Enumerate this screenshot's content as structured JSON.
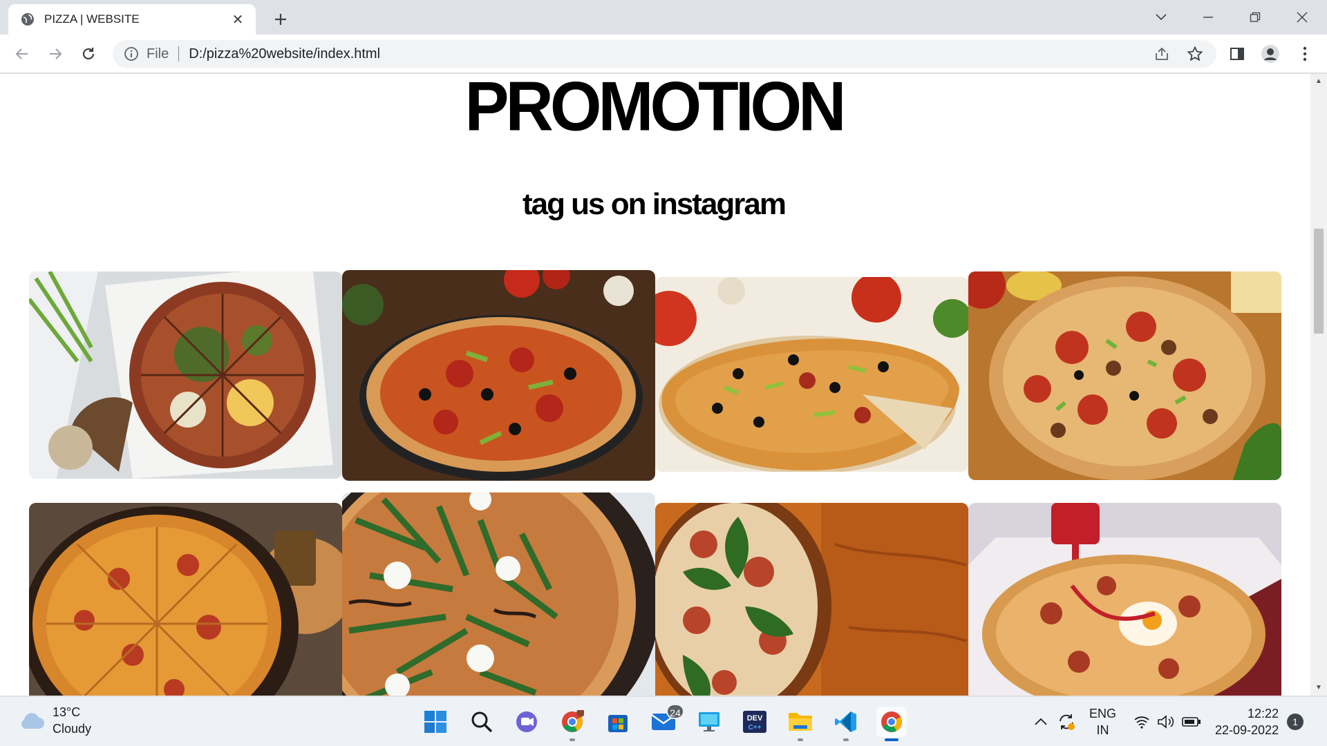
{
  "browser": {
    "tab_title": "PIZZA | WEBSITE",
    "omnibox_scheme_label": "File",
    "omnibox_url": "D:/pizza%20website/index.html"
  },
  "page": {
    "heading": "PROMOTION",
    "subheading": "tag us on instagram",
    "gallery": [
      {
        "alt": "pizza with green onions on paper"
      },
      {
        "alt": "pepperoni olive pizza on rack"
      },
      {
        "alt": "supreme pizza with missing slice"
      },
      {
        "alt": "sausage pepperoni pizza"
      },
      {
        "alt": "cheese pepperoni pizza on wood"
      },
      {
        "alt": "arugula balsamic pizza"
      },
      {
        "alt": "prosciutto arugula pizza"
      },
      {
        "alt": "pizza with egg and sauce bottle"
      }
    ]
  },
  "taskbar": {
    "weather_temp": "13°C",
    "weather_desc": "Cloudy",
    "mail_badge": "24",
    "lang_top": "ENG",
    "lang_bottom": "IN",
    "time": "12:22",
    "date": "22-09-2022",
    "notification_count": "1"
  },
  "colors": {
    "chrome_bg": "#dee1e6",
    "accent_blue": "#0a64c8"
  }
}
